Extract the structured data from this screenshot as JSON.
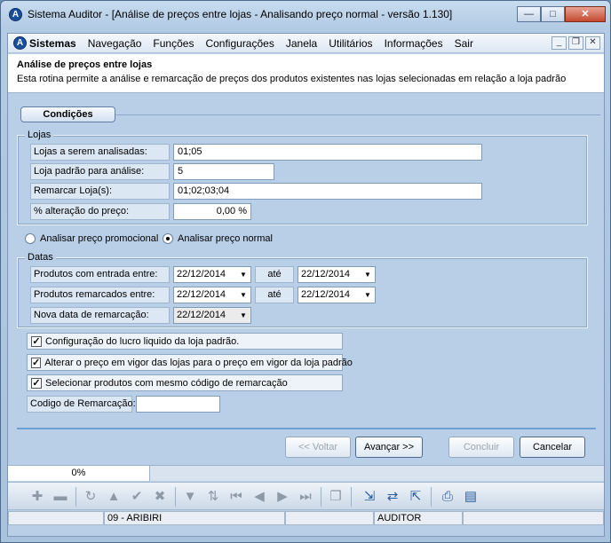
{
  "window": {
    "title": "Sistema Auditor - [Análise de preços entre lojas - Analisando preço normal - versão 1.130]",
    "buttons": {
      "minimize": "—",
      "maximize": "□",
      "close": "✕"
    }
  },
  "menu": {
    "items": [
      "Sistemas",
      "Navegação",
      "Funções",
      "Configurações",
      "Janela",
      "Utilitários",
      "Informações",
      "Sair"
    ],
    "mdi": {
      "minimize": "_",
      "restore": "❐",
      "close": "✕"
    }
  },
  "header": {
    "title": "Análise de preços entre lojas",
    "description": "Esta rotina permite a análise e remarcação de preços dos produtos existentes nas lojas selecionadas em relação a loja padrão"
  },
  "tab": {
    "label": "Condições"
  },
  "lojas": {
    "legend": "Lojas",
    "analisadas_label": "Lojas a serem analisadas:",
    "analisadas_value": "01;05",
    "padrao_label": "Loja padrão para análise:",
    "padrao_value": "5",
    "remarcar_label": "Remarcar Loja(s):",
    "remarcar_value": "01;02;03;04",
    "alteracao_label": "% alteração do preço:",
    "alteracao_value": "0,00 %"
  },
  "radios": {
    "promocional": "Analisar preço promocional",
    "normal": "Analisar preço normal",
    "selected": "normal"
  },
  "datas": {
    "legend": "Datas",
    "entrada_label": "Produtos com entrada entre:",
    "entrada_from": "22/12/2014",
    "entrada_to": "22/12/2014",
    "remarcados_label": "Produtos remarcados entre:",
    "remarcados_from": "22/12/2014",
    "remarcados_to": "22/12/2014",
    "ate_label": "até",
    "nova_label": "Nova data de remarcação:",
    "nova_value": "22/12/2014"
  },
  "checks": [
    {
      "label": "Configuração do lucro liquido da loja padrão.",
      "checked": true
    },
    {
      "label": "Alterar o preço em vigor das lojas para o preço em vigor da loja padrão",
      "checked": true
    },
    {
      "label": "Selecionar produtos com mesmo código de remarcação",
      "checked": true
    }
  ],
  "codigo": {
    "label": "Codigo de Remarcação:",
    "value": ""
  },
  "buttons": {
    "voltar": "<< Voltar",
    "avancar": "Avançar >>",
    "concluir": "Concluir",
    "cancelar": "Cancelar"
  },
  "progress": {
    "label": "0%",
    "value": 0
  },
  "toolbar_icons": [
    "plus-icon",
    "minus-icon",
    "redo-icon",
    "up-arrow-icon",
    "check-icon",
    "x-icon",
    "filter-icon",
    "sort-icon",
    "first-icon",
    "prev-icon",
    "next-icon",
    "last-icon",
    "copy-icon",
    "import-icon",
    "swap-icon",
    "export-icon",
    "print-icon",
    "report-icon"
  ],
  "status": {
    "loja": "09 - ARIBIRI",
    "user": "AUDITOR"
  }
}
